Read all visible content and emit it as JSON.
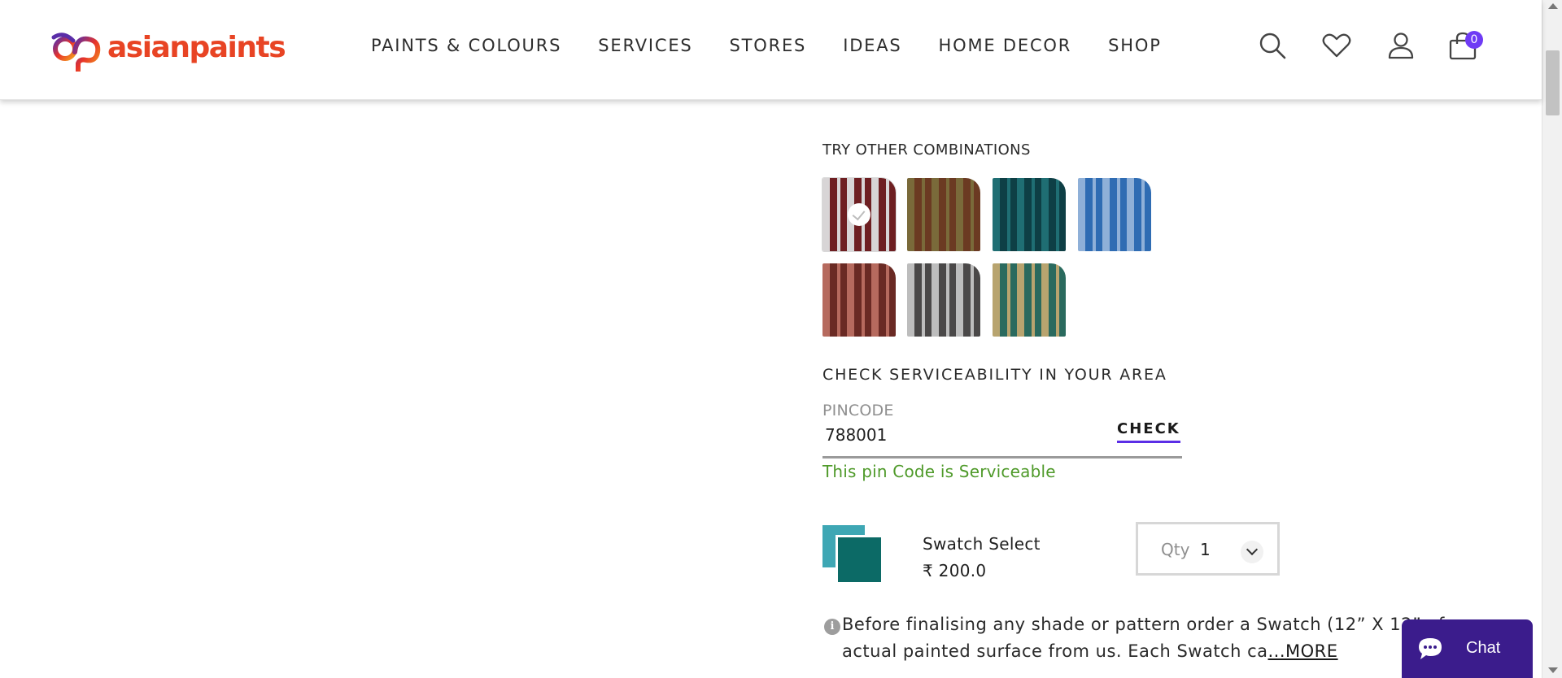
{
  "header": {
    "logo_text": "asianpaints",
    "nav": [
      "PAINTS & COLOURS",
      "SERVICES",
      "STORES",
      "IDEAS",
      "HOME DECOR",
      "SHOP"
    ],
    "icons": [
      "search-icon",
      "wishlist-heart-icon",
      "user-icon",
      "cart-bag-icon"
    ],
    "cart_count": "0"
  },
  "combinations": {
    "title": "TRY OTHER COMBINATIONS",
    "selected_index": 0,
    "swatches": [
      {
        "colors": [
          "#d8d5d6",
          "#6e1f22"
        ]
      },
      {
        "colors": [
          "#7a6a3a",
          "#6b3a22"
        ]
      },
      {
        "colors": [
          "#1f6e73",
          "#0e3f45"
        ]
      },
      {
        "colors": [
          "#8fb0d8",
          "#2f6cb3"
        ]
      },
      {
        "colors": [
          "#b66a5e",
          "#6a2a24"
        ]
      },
      {
        "colors": [
          "#bdbdbd",
          "#4a4848"
        ]
      },
      {
        "colors": [
          "#b8a46f",
          "#2a6a5e"
        ]
      }
    ]
  },
  "serviceability": {
    "title": "CHECK SERVICEABILITY IN YOUR AREA",
    "pincode_label": "PINCODE",
    "pincode_value": "788001",
    "check_label": "CHECK",
    "status": "This pin Code is Serviceable",
    "status_color": "#4f9a2a"
  },
  "product": {
    "name": "Swatch Select",
    "price": "₹ 200.0",
    "qty_label": "Qty",
    "qty_value": "1"
  },
  "note": {
    "line1": "Before finalising any shade or pattern order a Swatch (12” X 12” of",
    "line2": "actual painted surface from us. Each Swatch ca",
    "more": "...MORE"
  },
  "chat": {
    "label": "Chat"
  },
  "colors": {
    "brand": "#e84424",
    "accent": "#5b2ee6",
    "chat_bg": "#3b1c8c"
  }
}
